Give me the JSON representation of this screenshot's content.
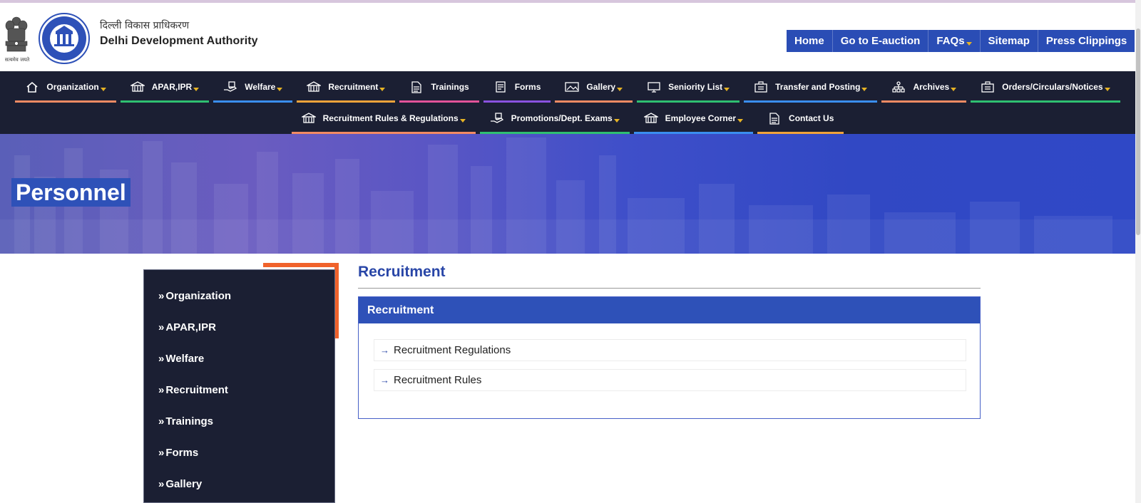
{
  "header": {
    "emblem_caption": "सत्यमेव जयते",
    "org_hindi": "दिल्ली विकास प्राधिकरण",
    "org_name": "Delhi Development Authority"
  },
  "topnav": [
    {
      "label": "Home",
      "has_dropdown": false
    },
    {
      "label": "Go to E-auction",
      "has_dropdown": false
    },
    {
      "label": "FAQs",
      "has_dropdown": true
    },
    {
      "label": "Sitemap",
      "has_dropdown": false
    },
    {
      "label": "Press Clippings",
      "has_dropdown": false
    }
  ],
  "mainnav": {
    "row1": [
      {
        "label": "Organization",
        "icon": "home-icon",
        "dropdown": true,
        "underline": "#f28a63"
      },
      {
        "label": "APAR,IPR",
        "icon": "building-icon",
        "dropdown": true,
        "underline": "#2fbf71"
      },
      {
        "label": "Welfare",
        "icon": "hand-icon",
        "dropdown": true,
        "underline": "#3a8ef0"
      },
      {
        "label": "Recruitment",
        "icon": "building-icon",
        "dropdown": true,
        "underline": "#f0a33a"
      },
      {
        "label": "Trainings",
        "icon": "document-icon",
        "dropdown": false,
        "underline": "#e2539a"
      },
      {
        "label": "Forms",
        "icon": "forms-icon",
        "dropdown": false,
        "underline": "#8a52e0"
      },
      {
        "label": "Gallery",
        "icon": "gallery-icon",
        "dropdown": true,
        "underline": "#f28a63"
      },
      {
        "label": "Seniority List",
        "icon": "monitor-icon",
        "dropdown": true,
        "underline": "#2fbf71"
      },
      {
        "label": "Transfer and Posting",
        "icon": "briefcase-icon",
        "dropdown": true,
        "underline": "#3a8ef0"
      },
      {
        "label": "Archives",
        "icon": "archive-icon",
        "dropdown": true,
        "underline": "#f28a63"
      },
      {
        "label": "Orders/Circulars/Notices",
        "icon": "briefcase-icon",
        "dropdown": true,
        "underline": "#2fbf71"
      }
    ],
    "row2": [
      {
        "label": "Recruitment Rules & Regulations",
        "icon": "building-icon",
        "dropdown": true,
        "underline": "#f28a63"
      },
      {
        "label": "Promotions/Dept. Exams",
        "icon": "hand-icon",
        "dropdown": true,
        "underline": "#2fbf71"
      },
      {
        "label": "Employee Corner",
        "icon": "building-icon",
        "dropdown": true,
        "underline": "#3a8ef0"
      },
      {
        "label": "Contact Us",
        "icon": "document-icon",
        "dropdown": false,
        "underline": "#f0a33a"
      }
    ]
  },
  "banner": {
    "title": "Personnel"
  },
  "sidebar": {
    "items": [
      {
        "label": "Organization"
      },
      {
        "label": "APAR,IPR"
      },
      {
        "label": "Welfare"
      },
      {
        "label": "Recruitment"
      },
      {
        "label": "Trainings"
      },
      {
        "label": "Forms"
      },
      {
        "label": "Gallery"
      }
    ]
  },
  "content": {
    "title": "Recruitment",
    "panel_title": "Recruitment",
    "links": [
      {
        "label": "Recruitment Regulations"
      },
      {
        "label": "Recruitment Rules"
      }
    ]
  },
  "colors": {
    "accent_blue": "#2e51b8",
    "nav_dark": "#1b1f33",
    "sidebar_accent": "#f0622b",
    "dropdown_caret": "#e6b325"
  }
}
